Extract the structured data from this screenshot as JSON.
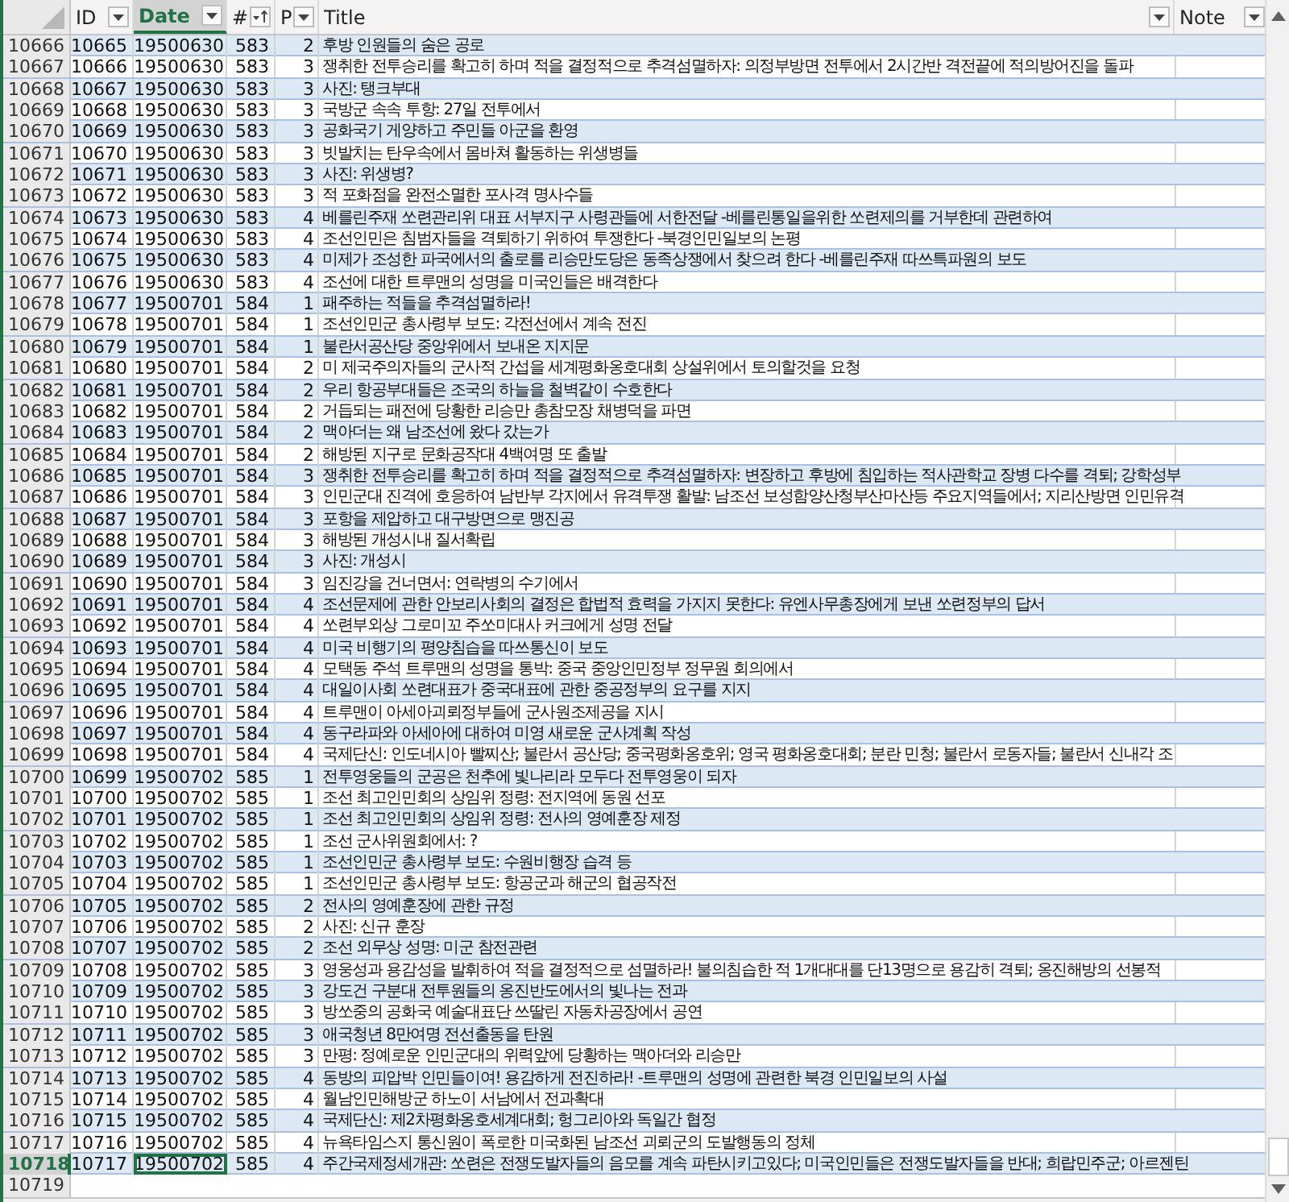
{
  "columns": [
    {
      "label": "ID",
      "selected": false,
      "sorted": false
    },
    {
      "label": "Date",
      "selected": true,
      "sorted": false
    },
    {
      "label": "#",
      "selected": false,
      "sorted": true
    },
    {
      "label": "P",
      "selected": false,
      "sorted": false
    },
    {
      "label": "Title",
      "selected": false,
      "sorted": false
    },
    {
      "label": "Note",
      "selected": false,
      "sorted": false
    }
  ],
  "rows": [
    {
      "row": "10666",
      "id": "10665",
      "date": "19500630",
      "num": "583",
      "p": "2",
      "title": "후방 인원들의 숨은 공로",
      "selected": false
    },
    {
      "row": "10667",
      "id": "10666",
      "date": "19500630",
      "num": "583",
      "p": "3",
      "title": "쟁취한 전투승리를 확고히 하며 적을 결정적으로 추격섬멸하자: 의정부방면 전투에서 2시간반 격전끝에 적의방어진을 돌파",
      "selected": false
    },
    {
      "row": "10668",
      "id": "10667",
      "date": "19500630",
      "num": "583",
      "p": "3",
      "title": "사진: 탱크부대",
      "selected": false
    },
    {
      "row": "10669",
      "id": "10668",
      "date": "19500630",
      "num": "583",
      "p": "3",
      "title": "국방군 속속 투항: 27일 전투에서",
      "selected": false
    },
    {
      "row": "10670",
      "id": "10669",
      "date": "19500630",
      "num": "583",
      "p": "3",
      "title": "공화국기 게양하고 주민들 아군을 환영",
      "selected": false
    },
    {
      "row": "10671",
      "id": "10670",
      "date": "19500630",
      "num": "583",
      "p": "3",
      "title": "빗발치는 탄우속에서 몸바쳐 활동하는 위생병들",
      "selected": false
    },
    {
      "row": "10672",
      "id": "10671",
      "date": "19500630",
      "num": "583",
      "p": "3",
      "title": "사진: 위생병?",
      "selected": false
    },
    {
      "row": "10673",
      "id": "10672",
      "date": "19500630",
      "num": "583",
      "p": "3",
      "title": "적 포화점을 완전소멸한 포사격 명사수들",
      "selected": false
    },
    {
      "row": "10674",
      "id": "10673",
      "date": "19500630",
      "num": "583",
      "p": "4",
      "title": "베를린주재 쏘련관리위 대표 서부지구 사령관들에 서한전달 -베를린통일을위한 쏘련제의를 거부한데 관련하여",
      "selected": false
    },
    {
      "row": "10675",
      "id": "10674",
      "date": "19500630",
      "num": "583",
      "p": "4",
      "title": "조선인민은 침범자들을 격퇴하기 위하여 투쟁한다 -북경인민일보의 논평",
      "selected": false
    },
    {
      "row": "10676",
      "id": "10675",
      "date": "19500630",
      "num": "583",
      "p": "4",
      "title": "미제가 조성한 파국에서의 출로를 리승만도당은 동족상쟁에서 찾으려 한다 -베를린주재 따쓰특파원의 보도",
      "selected": false
    },
    {
      "row": "10677",
      "id": "10676",
      "date": "19500630",
      "num": "583",
      "p": "4",
      "title": "조선에 대한 트루맨의 성명을 미국인들은 배격한다",
      "selected": false
    },
    {
      "row": "10678",
      "id": "10677",
      "date": "19500701",
      "num": "584",
      "p": "1",
      "title": "패주하는 적들을 추격섬멸하라!",
      "selected": false
    },
    {
      "row": "10679",
      "id": "10678",
      "date": "19500701",
      "num": "584",
      "p": "1",
      "title": "조선인민군 총사령부 보도: 각전선에서 계속 전진",
      "selected": false
    },
    {
      "row": "10680",
      "id": "10679",
      "date": "19500701",
      "num": "584",
      "p": "1",
      "title": "불란서공산당 중앙위에서 보내온 지지문",
      "selected": false
    },
    {
      "row": "10681",
      "id": "10680",
      "date": "19500701",
      "num": "584",
      "p": "2",
      "title": "미 제국주의자들의 군사적 간섭을 세계평화옹호대회 상설위에서 토의할것을 요청",
      "selected": false
    },
    {
      "row": "10682",
      "id": "10681",
      "date": "19500701",
      "num": "584",
      "p": "2",
      "title": "우리 항공부대들은 조국의 하늘을 철벽같이 수호한다",
      "selected": false
    },
    {
      "row": "10683",
      "id": "10682",
      "date": "19500701",
      "num": "584",
      "p": "2",
      "title": "거듭되는 패전에 당황한 리승만 총참모장 채병덕을 파면",
      "selected": false
    },
    {
      "row": "10684",
      "id": "10683",
      "date": "19500701",
      "num": "584",
      "p": "2",
      "title": "맥아더는 왜 남조선에 왔다 갔는가",
      "selected": false
    },
    {
      "row": "10685",
      "id": "10684",
      "date": "19500701",
      "num": "584",
      "p": "2",
      "title": "해방된 지구로 문화공작대 4백여명 또 출발",
      "selected": false
    },
    {
      "row": "10686",
      "id": "10685",
      "date": "19500701",
      "num": "584",
      "p": "3",
      "title": "쟁취한 전투승리를 확고히 하며 적을 결정적으로 추격섬멸하자: 변장하고 후방에 침입하는 적사관학교 장병 다수를 격퇴; 강학성부",
      "selected": false
    },
    {
      "row": "10687",
      "id": "10686",
      "date": "19500701",
      "num": "584",
      "p": "3",
      "title": "인민군대 진격에 호응하여 남반부 각지에서 유격투쟁 활발: 남조선 보성함양산청부산마산등 주요지역들에서; 지리산방면 인민유격",
      "selected": false
    },
    {
      "row": "10688",
      "id": "10687",
      "date": "19500701",
      "num": "584",
      "p": "3",
      "title": "포항을 제압하고 대구방면으로 맹진공",
      "selected": false
    },
    {
      "row": "10689",
      "id": "10688",
      "date": "19500701",
      "num": "584",
      "p": "3",
      "title": "해방된 개성시내 질서확립",
      "selected": false
    },
    {
      "row": "10690",
      "id": "10689",
      "date": "19500701",
      "num": "584",
      "p": "3",
      "title": "사진: 개성시",
      "selected": false
    },
    {
      "row": "10691",
      "id": "10690",
      "date": "19500701",
      "num": "584",
      "p": "3",
      "title": "임진강을 건너면서: 연락병의 수기에서",
      "selected": false
    },
    {
      "row": "10692",
      "id": "10691",
      "date": "19500701",
      "num": "584",
      "p": "4",
      "title": "조선문제에 관한 안보리사회의 결정은 합법적 효력을 가지지 못한다: 유엔사무총장에게 보낸 쏘련정부의 답서",
      "selected": false
    },
    {
      "row": "10693",
      "id": "10692",
      "date": "19500701",
      "num": "584",
      "p": "4",
      "title": "쏘련부외상 그로미꼬 주쏘미대사 커크에게 성명 전달",
      "selected": false
    },
    {
      "row": "10694",
      "id": "10693",
      "date": "19500701",
      "num": "584",
      "p": "4",
      "title": "미국 비행기의 평양침습을 따쓰통신이 보도",
      "selected": false
    },
    {
      "row": "10695",
      "id": "10694",
      "date": "19500701",
      "num": "584",
      "p": "4",
      "title": "모택동 주석 트루맨의 성명을 통박: 중국 중앙인민정부 정무원 회의에서",
      "selected": false
    },
    {
      "row": "10696",
      "id": "10695",
      "date": "19500701",
      "num": "584",
      "p": "4",
      "title": "대일이사회 쏘련대표가 중국대표에 관한 중공정부의 요구를 지지",
      "selected": false
    },
    {
      "row": "10697",
      "id": "10696",
      "date": "19500701",
      "num": "584",
      "p": "4",
      "title": "트루맨이 아세아괴뢰정부들에 군사원조제공을 지시",
      "selected": false
    },
    {
      "row": "10698",
      "id": "10697",
      "date": "19500701",
      "num": "584",
      "p": "4",
      "title": "동구라파와 아세아에 대하여 미영 새로운 군사계획 작성",
      "selected": false
    },
    {
      "row": "10699",
      "id": "10698",
      "date": "19500701",
      "num": "584",
      "p": "4",
      "title": "국제단신: 인도네시아 빨찌산; 불란서 공산당; 중국평화옹호위; 영국 평화옹호대회; 분란 민청; 불란서 로동자들; 불란서 신내각 조",
      "selected": false
    },
    {
      "row": "10700",
      "id": "10699",
      "date": "19500702",
      "num": "585",
      "p": "1",
      "title": "전투영웅들의 군공은 천추에 빛나리라 모두다 전투영웅이 되자",
      "selected": false
    },
    {
      "row": "10701",
      "id": "10700",
      "date": "19500702",
      "num": "585",
      "p": "1",
      "title": "조선 최고인민회의 상임위 정령: 전지역에 동원 선포",
      "selected": false
    },
    {
      "row": "10702",
      "id": "10701",
      "date": "19500702",
      "num": "585",
      "p": "1",
      "title": "조선 최고인민회의 상임위 정령: 전사의 영예훈장 제정",
      "selected": false
    },
    {
      "row": "10703",
      "id": "10702",
      "date": "19500702",
      "num": "585",
      "p": "1",
      "title": "조선 군사위원회에서: ?",
      "selected": false
    },
    {
      "row": "10704",
      "id": "10703",
      "date": "19500702",
      "num": "585",
      "p": "1",
      "title": "조선인민군 총사령부 보도: 수원비행장 습격 등",
      "selected": false
    },
    {
      "row": "10705",
      "id": "10704",
      "date": "19500702",
      "num": "585",
      "p": "1",
      "title": "조선인민군 총사령부 보도: 항공군과 해군의 협공작전",
      "selected": false
    },
    {
      "row": "10706",
      "id": "10705",
      "date": "19500702",
      "num": "585",
      "p": "2",
      "title": "전사의 영예훈장에 관한 규정",
      "selected": false
    },
    {
      "row": "10707",
      "id": "10706",
      "date": "19500702",
      "num": "585",
      "p": "2",
      "title": "사진: 신규 훈장",
      "selected": false
    },
    {
      "row": "10708",
      "id": "10707",
      "date": "19500702",
      "num": "585",
      "p": "2",
      "title": "조선 외무상 성명: 미군 참전관련",
      "selected": false
    },
    {
      "row": "10709",
      "id": "10708",
      "date": "19500702",
      "num": "585",
      "p": "3",
      "title": "영웅성과 용감성을 발휘하여 적을 결정적으로 섬멸하라! 불의침습한 적 1개대대를 단13명으로 용감히 격퇴; 옹진해방의 선봉적",
      "selected": false
    },
    {
      "row": "10710",
      "id": "10709",
      "date": "19500702",
      "num": "585",
      "p": "3",
      "title": "강도건 구분대 전투원들의 옹진반도에서의 빛나는 전과",
      "selected": false
    },
    {
      "row": "10711",
      "id": "10710",
      "date": "19500702",
      "num": "585",
      "p": "3",
      "title": "방쏘중의 공화국 예술대표단 쓰딸린 자동차공장에서 공연",
      "selected": false
    },
    {
      "row": "10712",
      "id": "10711",
      "date": "19500702",
      "num": "585",
      "p": "3",
      "title": "애국청년 8만여명 전선출동을 탄원",
      "selected": false
    },
    {
      "row": "10713",
      "id": "10712",
      "date": "19500702",
      "num": "585",
      "p": "3",
      "title": "만평: 정예로운 인민군대의 위력앞에 당황하는 맥아더와 리승만",
      "selected": false
    },
    {
      "row": "10714",
      "id": "10713",
      "date": "19500702",
      "num": "585",
      "p": "4",
      "title": "동방의 피압박 인민들이여! 용감하게 전진하라! -트루맨의 성명에 관련한 북경 인민일보의 사설",
      "selected": false
    },
    {
      "row": "10715",
      "id": "10714",
      "date": "19500702",
      "num": "585",
      "p": "4",
      "title": "월남인민해방군 하노이 서남에서 전과확대",
      "selected": false
    },
    {
      "row": "10716",
      "id": "10715",
      "date": "19500702",
      "num": "585",
      "p": "4",
      "title": "국제단신: 제2차평화옹호세계대회; 헝그리아와 독일간 협정",
      "selected": false
    },
    {
      "row": "10717",
      "id": "10716",
      "date": "19500702",
      "num": "585",
      "p": "4",
      "title": "뉴욕타임스지 통신원이 폭로한 미국화된 남조선 괴뢰군의 도발행동의 정체",
      "selected": false
    },
    {
      "row": "10718",
      "id": "10717",
      "date": "19500702",
      "num": "585",
      "p": "4",
      "title": "주간국제정세개관: 쏘련은 전쟁도발자들의 음모를 계속 파탄시키고있다; 미국인민들은 전쟁도발자들을 반대; 희랍민주군; 아르젠틴",
      "selected": true
    }
  ],
  "empty_rows": [
    "10719"
  ]
}
